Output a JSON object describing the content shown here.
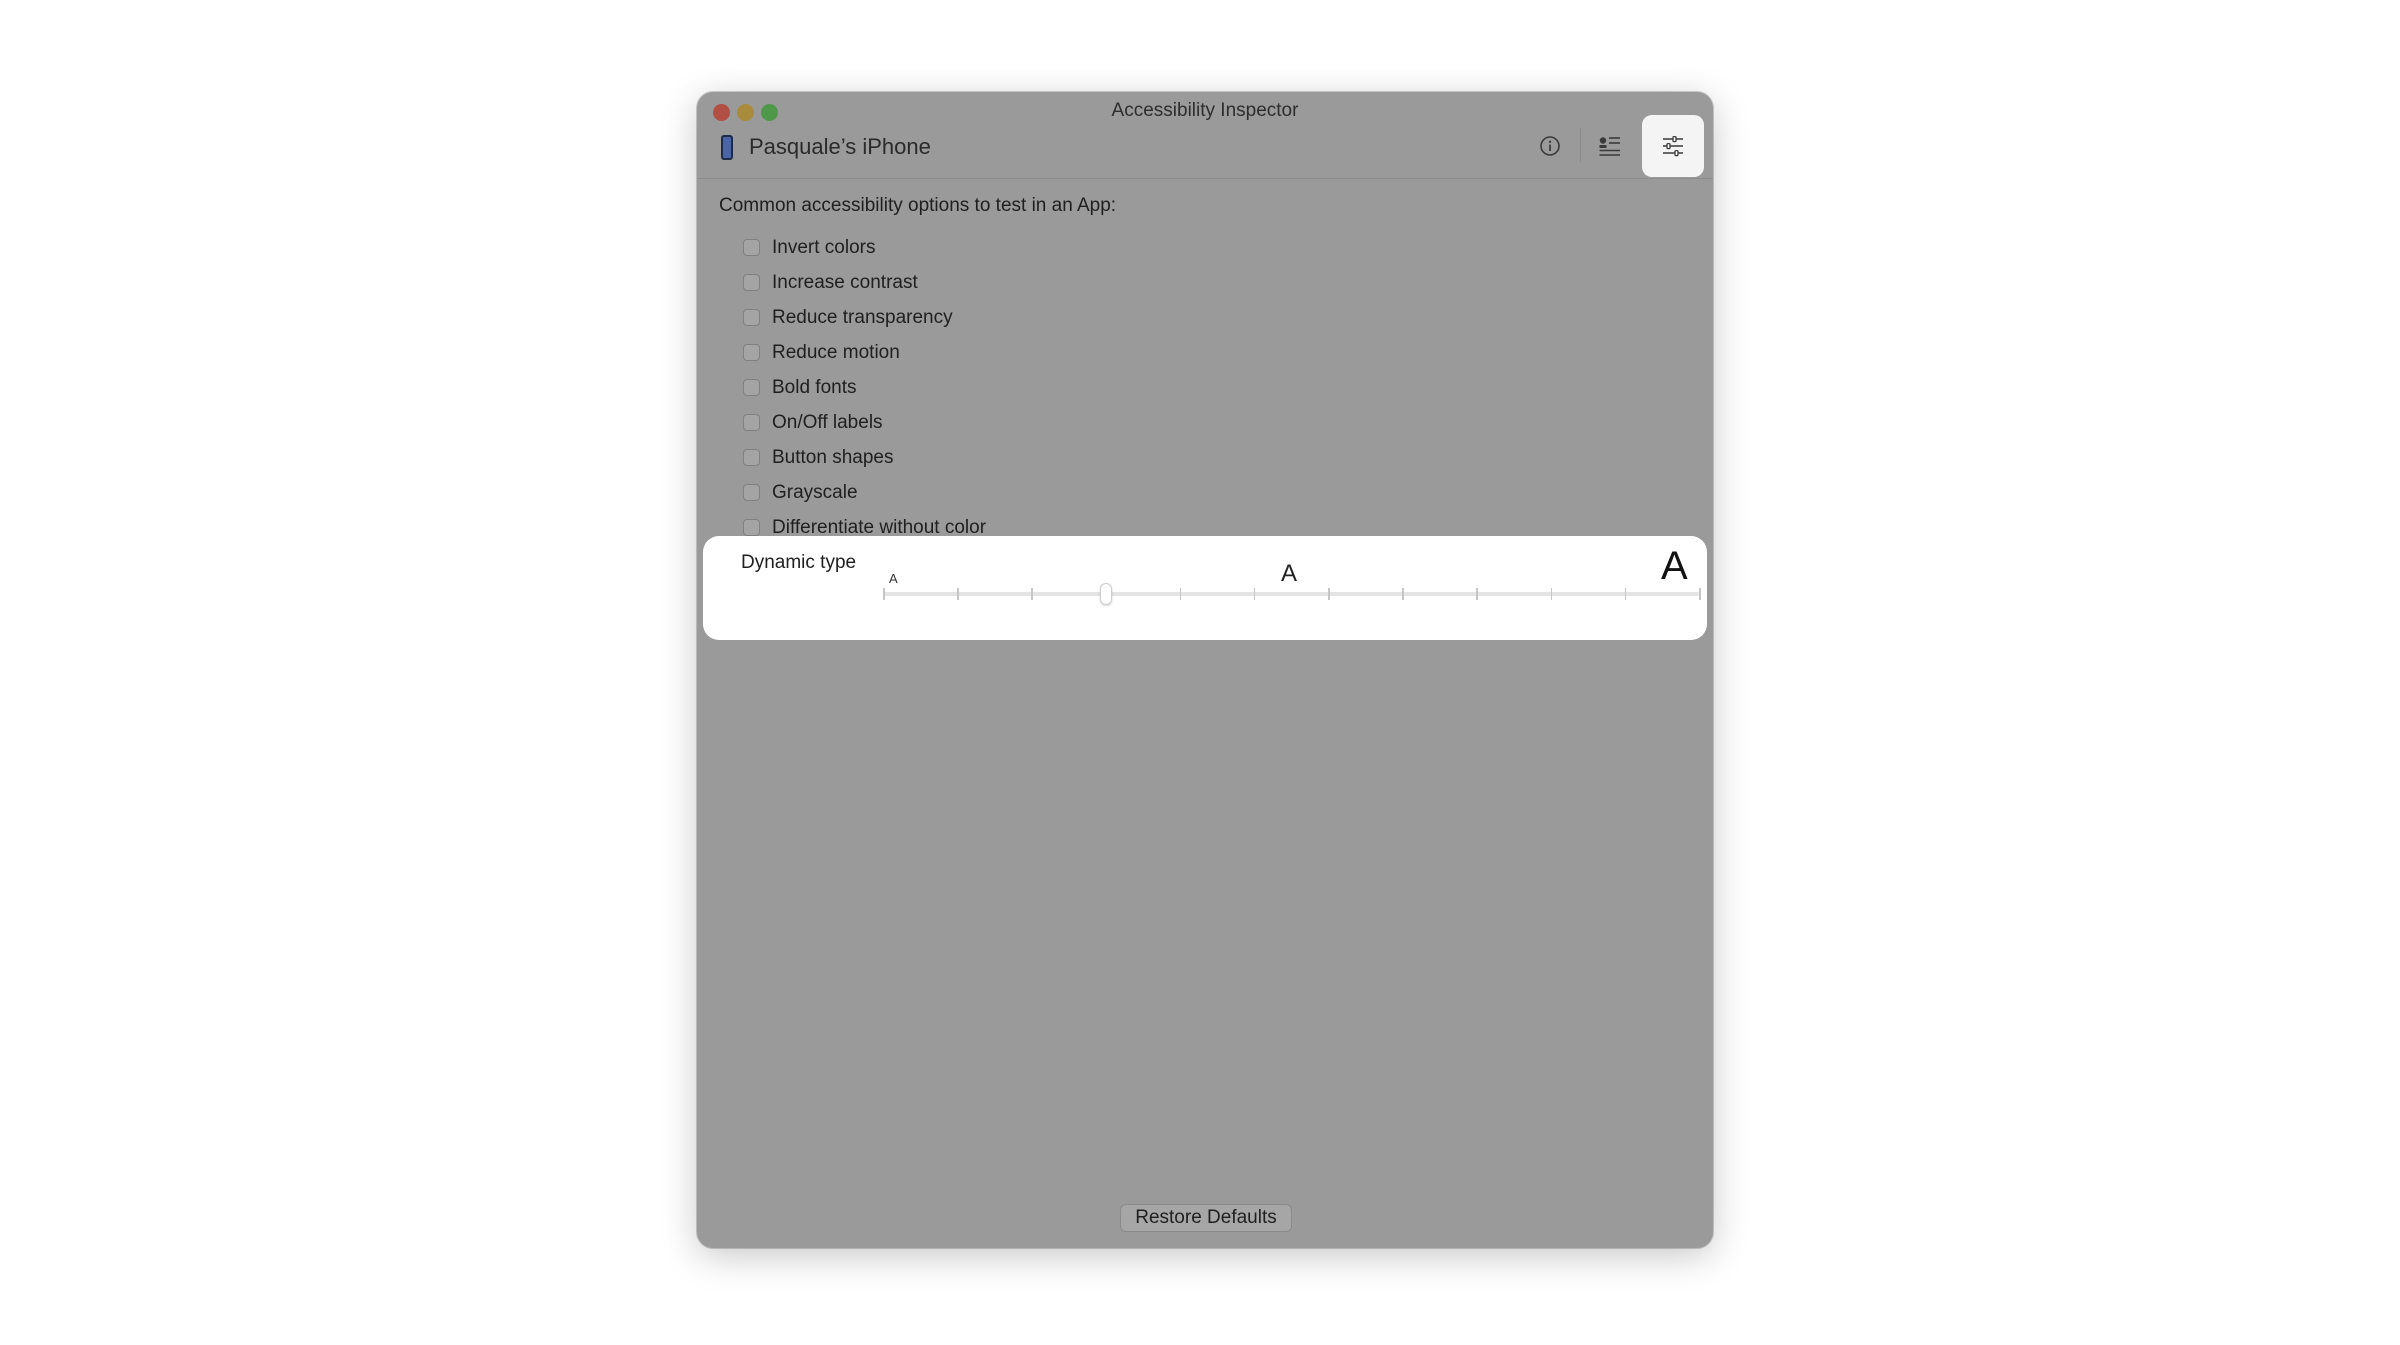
{
  "window": {
    "title": "Accessibility Inspector"
  },
  "toolbar": {
    "device_name": "Pasquale’s iPhone",
    "device_icon": "iphone-icon",
    "info_icon": "info-circle-icon",
    "list_icon": "audit-list-icon",
    "settings_icon": "sliders-icon",
    "active_tab": "settings"
  },
  "settings": {
    "intro": "Common accessibility options to test in an App:",
    "options": [
      {
        "label": "Invert colors",
        "checked": false
      },
      {
        "label": "Increase contrast",
        "checked": false
      },
      {
        "label": "Reduce transparency",
        "checked": false
      },
      {
        "label": "Reduce motion",
        "checked": false
      },
      {
        "label": "Bold fonts",
        "checked": false
      },
      {
        "label": "On/Off labels",
        "checked": false
      },
      {
        "label": "Button shapes",
        "checked": false
      },
      {
        "label": "Grayscale",
        "checked": false
      },
      {
        "label": "Differentiate without color",
        "checked": false
      }
    ],
    "dynamic_type": {
      "label": "Dynamic type",
      "small_glyph": "A",
      "medium_glyph": "A",
      "large_glyph": "A",
      "steps": 12,
      "selected_step": 3
    },
    "restore_label": "Restore Defaults"
  },
  "colors": {
    "overlay_gray": "#9a9a9a",
    "highlight": "#ffffff"
  }
}
